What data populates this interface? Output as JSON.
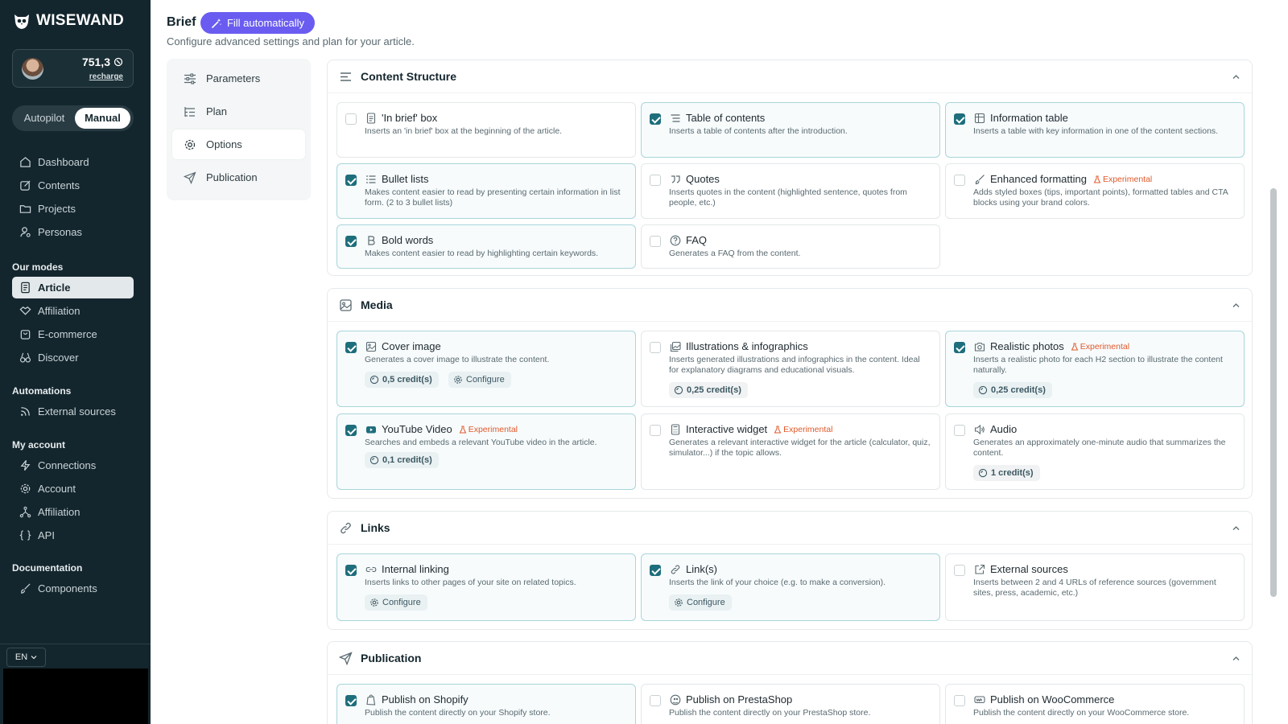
{
  "sidebar": {
    "logo": "WISEWAND",
    "credits": "751,3",
    "recharge": "recharge",
    "mode": {
      "autopilot": "Autopilot",
      "manual": "Manual"
    },
    "nav": [
      "Dashboard",
      "Contents",
      "Projects",
      "Personas"
    ],
    "our_modes_title": "Our modes",
    "modes": [
      "Article",
      "Affiliation",
      "E-commerce",
      "Discover"
    ],
    "automations_title": "Automations",
    "automations": [
      "External sources"
    ],
    "account_title": "My account",
    "account": [
      "Connections",
      "Account",
      "Affiliation",
      "API"
    ],
    "documentation_title": "Documentation",
    "documentation": [
      "Components"
    ],
    "language": "EN"
  },
  "header": {
    "title": "Brief",
    "fill_button": "Fill automatically",
    "subtitle": "Configure advanced settings and plan for your article."
  },
  "tabs": [
    "Parameters",
    "Plan",
    "Options",
    "Publication"
  ],
  "experimental_label": "Experimental",
  "configure_label": "Configure",
  "sections": {
    "content_structure": {
      "title": "Content Structure",
      "cards": [
        {
          "title": "'In brief' box",
          "desc": "Inserts an 'in brief' box at the beginning of the article.",
          "checked": false
        },
        {
          "title": "Table of contents",
          "desc": "Inserts a table of contents after the introduction.",
          "checked": true
        },
        {
          "title": "Information table",
          "desc": "Inserts a table with key information in one of the content sections.",
          "checked": true
        },
        {
          "title": "Bullet lists",
          "desc": "Makes content easier to read by presenting certain information in list form. (2 to 3 bullet lists)",
          "checked": true
        },
        {
          "title": "Quotes",
          "desc": "Inserts quotes in the content (highlighted sentence, quotes from people, etc.)",
          "checked": false
        },
        {
          "title": "Enhanced formatting",
          "desc": "Adds styled boxes (tips, important points), formatted tables and CTA blocks using your brand colors.",
          "checked": false
        },
        {
          "title": "Bold words",
          "desc": "Makes content easier to read by highlighting certain keywords.",
          "checked": true
        },
        {
          "title": "FAQ",
          "desc": "Generates a FAQ from the content.",
          "checked": false
        }
      ]
    },
    "media": {
      "title": "Media",
      "cards": [
        {
          "title": "Cover image",
          "desc": "Generates a cover image to illustrate the content.",
          "credit": "0,5 credit(s)",
          "checked": true
        },
        {
          "title": "Illustrations & infographics",
          "desc": "Inserts generated illustrations and infographics in the content. Ideal for explanatory diagrams and educational visuals.",
          "credit": "0,25 credit(s)",
          "checked": false
        },
        {
          "title": "Realistic photos",
          "desc": "Inserts a realistic photo for each H2 section to illustrate the content naturally.",
          "credit": "0,25 credit(s)",
          "checked": true
        },
        {
          "title": "YouTube Video",
          "desc": "Searches and embeds a relevant YouTube video in the article.",
          "credit": "0,1 credit(s)",
          "checked": true
        },
        {
          "title": "Interactive widget",
          "desc": "Generates a relevant interactive widget for the article (calculator, quiz, simulator...) if the topic allows.",
          "checked": false
        },
        {
          "title": "Audio",
          "desc": "Generates an approximately one-minute audio that summarizes the content.",
          "credit": "1 credit(s)",
          "checked": false
        }
      ]
    },
    "links": {
      "title": "Links",
      "cards": [
        {
          "title": "Internal linking",
          "desc": "Inserts links to other pages of your site on related topics.",
          "checked": true
        },
        {
          "title": "Link(s)",
          "desc": "Inserts the link of your choice (e.g. to make a conversion).",
          "checked": true
        },
        {
          "title": "External sources",
          "desc": "Inserts between 2 and 4 URLs of reference sources (government sites, press, academic, etc.)",
          "checked": false
        }
      ]
    },
    "publication": {
      "title": "Publication",
      "cards": [
        {
          "title": "Publish on Shopify",
          "desc": "Publish the content directly on your Shopify store.",
          "checked": true
        },
        {
          "title": "Publish on PrestaShop",
          "desc": "Publish the content directly on your PrestaShop store.",
          "checked": false
        },
        {
          "title": "Publish on WooCommerce",
          "desc": "Publish the content directly on your WooCommerce store.",
          "checked": false
        }
      ]
    }
  },
  "colors": {
    "sidebar_bg": "#14262d",
    "accent": "#1e6e7c",
    "fill_button": "#6a5cf0",
    "experimental": "#e0592b"
  }
}
